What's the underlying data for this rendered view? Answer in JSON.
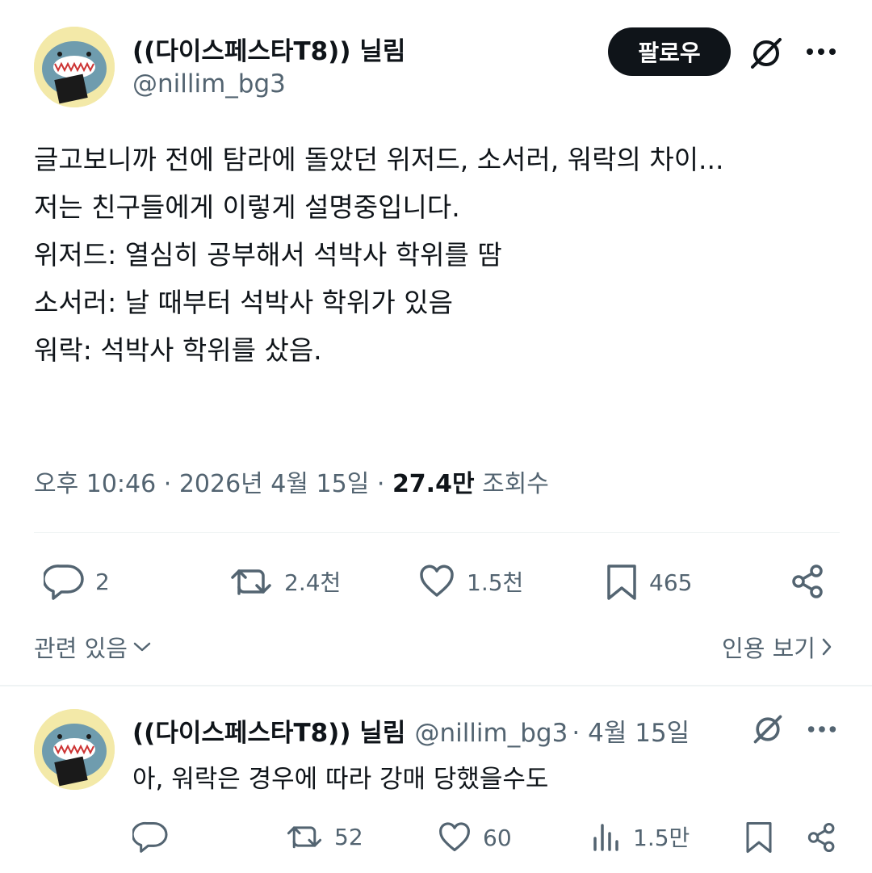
{
  "main_tweet": {
    "author_name": "((다이스페스타T8)) 닐림",
    "author_handle": "@nillim_bg3",
    "follow_label": "팔로우",
    "text_lines": [
      "글고보니까 전에 탐라에 돌았던 위저드, 소서러, 워락의 차이...",
      "저는 친구들에게 이렇게 설명중입니다.",
      "",
      "위저드: 열심히 공부해서 석박사 학위를 땀",
      "소서러: 날 때부터 석박사 학위가 있음",
      "워락: 석박사 학위를 샀음."
    ],
    "time": "오후 10:46",
    "date": "2026년 4월 15일",
    "views_count": "27.4만",
    "views_label": "조회수",
    "replies": "2",
    "retweets": "2.4천",
    "likes": "1.5천",
    "bookmarks": "465",
    "related_label": "관련 있음",
    "quotes_label": "인용 보기"
  },
  "reply_tweet": {
    "author_name": "((다이스페스타T8)) 닐림",
    "author_handle": "@nillim_bg3",
    "date": "4월 15일",
    "text": "아, 워락은 경우에 따라 강매 당했을수도",
    "replies": "",
    "retweets": "52",
    "likes": "60",
    "views": "1.5만"
  },
  "icons": {
    "grok": "grok-icon",
    "more": "more-icon",
    "reply": "reply-icon",
    "retweet": "retweet-icon",
    "like": "heart-icon",
    "bookmark": "bookmark-icon",
    "share": "share-icon",
    "views": "views-icon"
  },
  "colors": {
    "text": "#0f1419",
    "secondary": "#536471",
    "divider": "#eff3f4",
    "follow_bg": "#0f1419"
  }
}
